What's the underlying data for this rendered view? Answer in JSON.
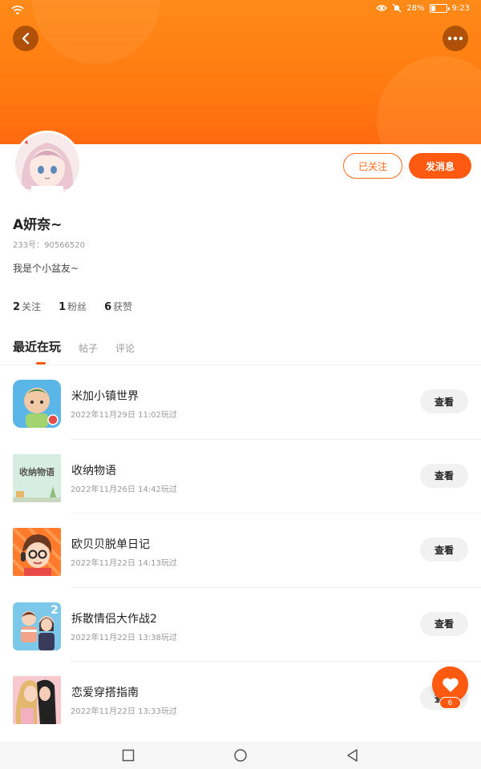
{
  "status_bar": {
    "battery_text": "28%",
    "battery_level": 0.28,
    "time": "9:23"
  },
  "header": {
    "banner_color": "#ff7a10",
    "back_icon": "chevron-left-icon",
    "more_icon": "more-horizontal-icon"
  },
  "profile": {
    "name": "A妍奈~",
    "id_label": "233号：",
    "id_value": "90566520",
    "bio": "我是个小盆友~",
    "follow_label": "已关注",
    "message_label": "发消息"
  },
  "stats": [
    {
      "value": "2",
      "label": "关注"
    },
    {
      "value": "1",
      "label": "粉丝"
    },
    {
      "value": "6",
      "label": "获赞"
    }
  ],
  "tabs": [
    {
      "label": "最近在玩",
      "active": true
    },
    {
      "label": "帖子",
      "active": false
    },
    {
      "label": "评论",
      "active": false
    }
  ],
  "games": [
    {
      "name": "米加小镇世界",
      "time": "2022年11月29日 11:02玩过",
      "action": "查看"
    },
    {
      "name": "收纳物语",
      "time": "2022年11月26日 14:42玩过",
      "action": "查看"
    },
    {
      "name": "欧贝贝脱单日记",
      "time": "2022年11月22日 14:13玩过",
      "action": "查看"
    },
    {
      "name": "拆散情侣大作战2",
      "time": "2022年11月22日 13:38玩过",
      "action": "查看"
    },
    {
      "name": "恋爱穿搭指南",
      "time": "2022年11月22日 13:33玩过",
      "action": "查看"
    }
  ],
  "game_icon_texts": {
    "storage_title": "收纳物语",
    "couple_number": "2"
  },
  "like": {
    "count": "6",
    "color": "#ff5a10"
  },
  "colors": {
    "accent": "#ff5a10",
    "muted_text": "#999999"
  }
}
